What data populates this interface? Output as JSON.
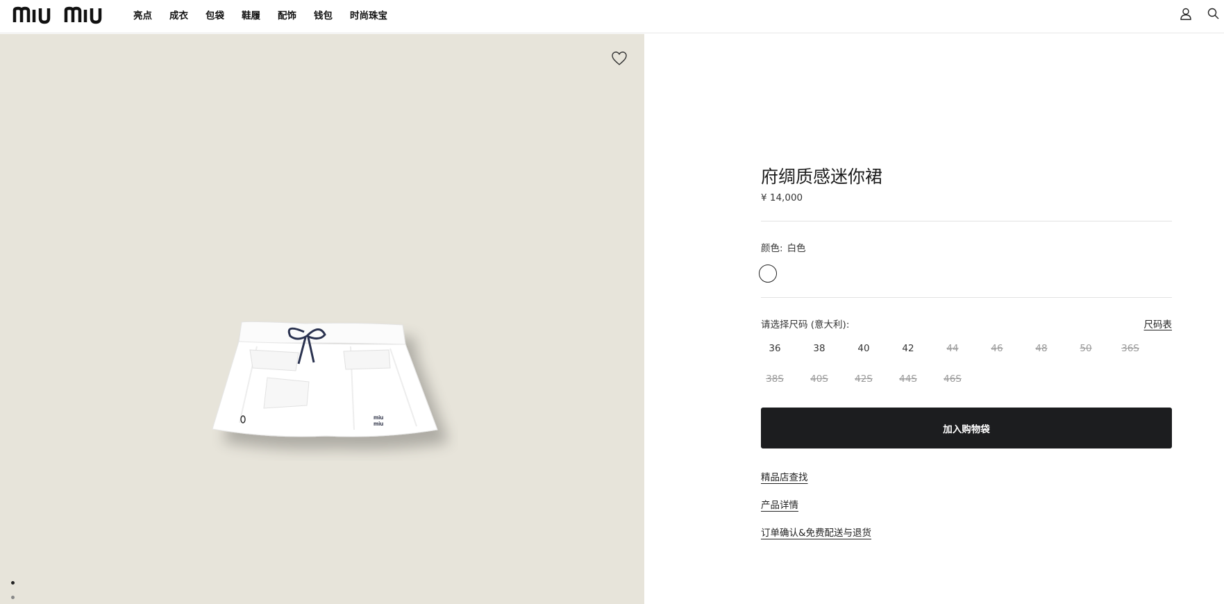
{
  "header": {
    "logo_text": "miu miu",
    "nav": [
      "亮点",
      "成衣",
      "包袋",
      "鞋履",
      "配饰",
      "钱包",
      "时尚珠宝"
    ]
  },
  "product": {
    "title": "府绸质感迷你裙",
    "price": "¥ 14,000",
    "color_label": "颜色:",
    "color_value": "白色",
    "size_label": "请选择尺码 (意大利):",
    "size_chart": "尺码表",
    "sizes": [
      {
        "label": "36",
        "available": true
      },
      {
        "label": "38",
        "available": true
      },
      {
        "label": "40",
        "available": true
      },
      {
        "label": "42",
        "available": true
      },
      {
        "label": "44",
        "available": false
      },
      {
        "label": "46",
        "available": false
      },
      {
        "label": "48",
        "available": false
      },
      {
        "label": "50",
        "available": false
      },
      {
        "label": "36S",
        "available": false
      },
      {
        "label": "38S",
        "available": false
      },
      {
        "label": "40S",
        "available": false
      },
      {
        "label": "42S",
        "available": false
      },
      {
        "label": "44S",
        "available": false
      },
      {
        "label": "46S",
        "available": false
      }
    ],
    "add_to_bag": "加入购物袋",
    "links": [
      "精品店查找",
      "产品详情",
      "订单确认&免费配送与退货"
    ]
  },
  "colors": {
    "image_bg": "#e7e4da",
    "button_bg": "#1c1d1f"
  }
}
